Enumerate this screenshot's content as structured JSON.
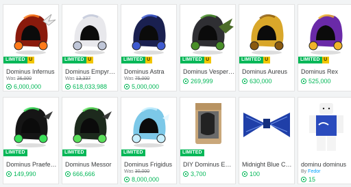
{
  "currency_icon": "robux-icon",
  "items": [
    {
      "name": "Dominus Infernus",
      "badges": {
        "limited": "LIMITED",
        "unique": "U"
      },
      "was_label": "Was",
      "was_price": "26,000",
      "price": "6,000,000",
      "thumb": "dominus-infernus",
      "color": "#8a1a0c"
    },
    {
      "name": "Dominus Empyreus",
      "badges": {
        "limited": "LIMITED",
        "unique": "U"
      },
      "was_label": "Was",
      "was_price": "13,337",
      "price": "618,033,988",
      "thumb": "dominus-empyreus",
      "color": "#e8e8ec"
    },
    {
      "name": "Dominus Astra",
      "badges": {
        "limited": "LIMITED",
        "unique": "U"
      },
      "was_label": "Was",
      "was_price": "75,000",
      "price": "5,000,000",
      "thumb": "dominus-astra",
      "color": "#1a2050"
    },
    {
      "name": "Dominus Vespertilio",
      "badges": {
        "limited": "LIMITED",
        "unique": "U"
      },
      "price": "269,999",
      "thumb": "dominus-vespertilio",
      "color": "#2f2f33"
    },
    {
      "name": "Dominus Aureus",
      "badges": {
        "limited": "LIMITED",
        "unique": "U"
      },
      "price": "630,000",
      "thumb": "dominus-aureus",
      "color": "#d9a72a"
    },
    {
      "name": "Dominus Rex",
      "badges": {
        "limited": "LIMITED",
        "unique": "U"
      },
      "price": "525,000",
      "thumb": "dominus-rex",
      "color": "#6a2aa8"
    },
    {
      "name": "Dominus Praefectus",
      "badges": {
        "limited": "LIMITED"
      },
      "price": "149,990",
      "thumb": "dominus-praefectus",
      "color": "#151515"
    },
    {
      "name": "Dominus Messor",
      "badges": {
        "limited": "LIMITED"
      },
      "price": "666,666",
      "thumb": "dominus-messor",
      "color": "#1d2a1d"
    },
    {
      "name": "Dominus Frigidus",
      "badges": {
        "limited": "LIMITED"
      },
      "was_label": "Was",
      "was_price": "30,000",
      "price": "8,000,000",
      "thumb": "dominus-frigidus",
      "color": "#7cc8e8"
    },
    {
      "name": "DIY Dominus Empyreus",
      "badges": {
        "limited": "LIMITED"
      },
      "price": "3,700",
      "thumb": "diy-dominus-empyreus",
      "color": "#c8a878"
    },
    {
      "name": "Midnight Blue Chain Bow Tie",
      "price": "100",
      "thumb": "midnight-blue-bow-tie",
      "color": "#1f3fa8"
    },
    {
      "name": "dominu dominus",
      "by_label": "By",
      "creator": "Fedor",
      "price": "15",
      "thumb": "dominu-dominus-shirt",
      "color": "#2a4bbd"
    }
  ]
}
